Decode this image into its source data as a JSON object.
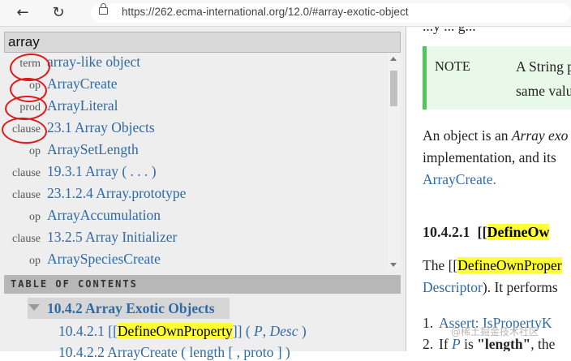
{
  "browser": {
    "url": "https://262.ecma-international.org/12.0/#array-exotic-object",
    "back_icon": "←",
    "reload_icon": "↻"
  },
  "menu": {
    "search_value": "array",
    "results": [
      {
        "kind": "term",
        "name": "array-like object"
      },
      {
        "kind": "op",
        "name": "ArrayCreate"
      },
      {
        "kind": "prod",
        "name": "ArrayLiteral"
      },
      {
        "kind": "clause",
        "name": "23.1 Array Objects"
      },
      {
        "kind": "op",
        "name": "ArraySetLength"
      },
      {
        "kind": "clause",
        "name": "19.3.1 Array ( . . . )"
      },
      {
        "kind": "clause",
        "name": "23.1.2.4 Array.prototype"
      },
      {
        "kind": "op",
        "name": "ArrayAccumulation"
      },
      {
        "kind": "clause",
        "name": "13.2.5 Array Initializer"
      },
      {
        "kind": "op",
        "name": "ArraySpeciesCreate"
      }
    ],
    "toc_header": "TABLE OF CONTENTS",
    "toc_selected": "10.4.2 Array Exotic Objects",
    "toc_item1_num": "10.4.2.1 [[",
    "toc_item1_hl": "DefineOwnProperty",
    "toc_item1_rest": "]] (",
    "toc_item1_p": "P",
    "toc_item1_sep": ",",
    "toc_item1_desc": "Desc",
    "toc_item1_end": ")",
    "toc_item2": "10.4.2.2 ArrayCreate ( length [ , proto ] )"
  },
  "content": {
    "top_partial": "...y ... g...",
    "note_label": "NOTE",
    "note_line1": "A String p",
    "note_line2": "same valu",
    "para_line1_a": "An object is an ",
    "para_line1_b": "Array exo",
    "para_line2": "implementation, and its",
    "para_line3": "ArrayCreate.",
    "heading_num": "10.4.2.1",
    "heading_open": "[[",
    "heading_hl": "DefineOw",
    "def_a": "The [[",
    "def_hl": "DefineOwnProper",
    "def_line2_link": "Descriptor",
    "def_line2_rest": "). It performs",
    "step1_num": "1.",
    "step1_text": "Assert: IsPropertyK",
    "step2_num": "2.",
    "step2_a": "If ",
    "step2_p": "P",
    "step2_b": " is ",
    "step2_c": "\"length\"",
    "step2_d": ", the"
  },
  "watermark": "@稀土掘金技术社区"
}
